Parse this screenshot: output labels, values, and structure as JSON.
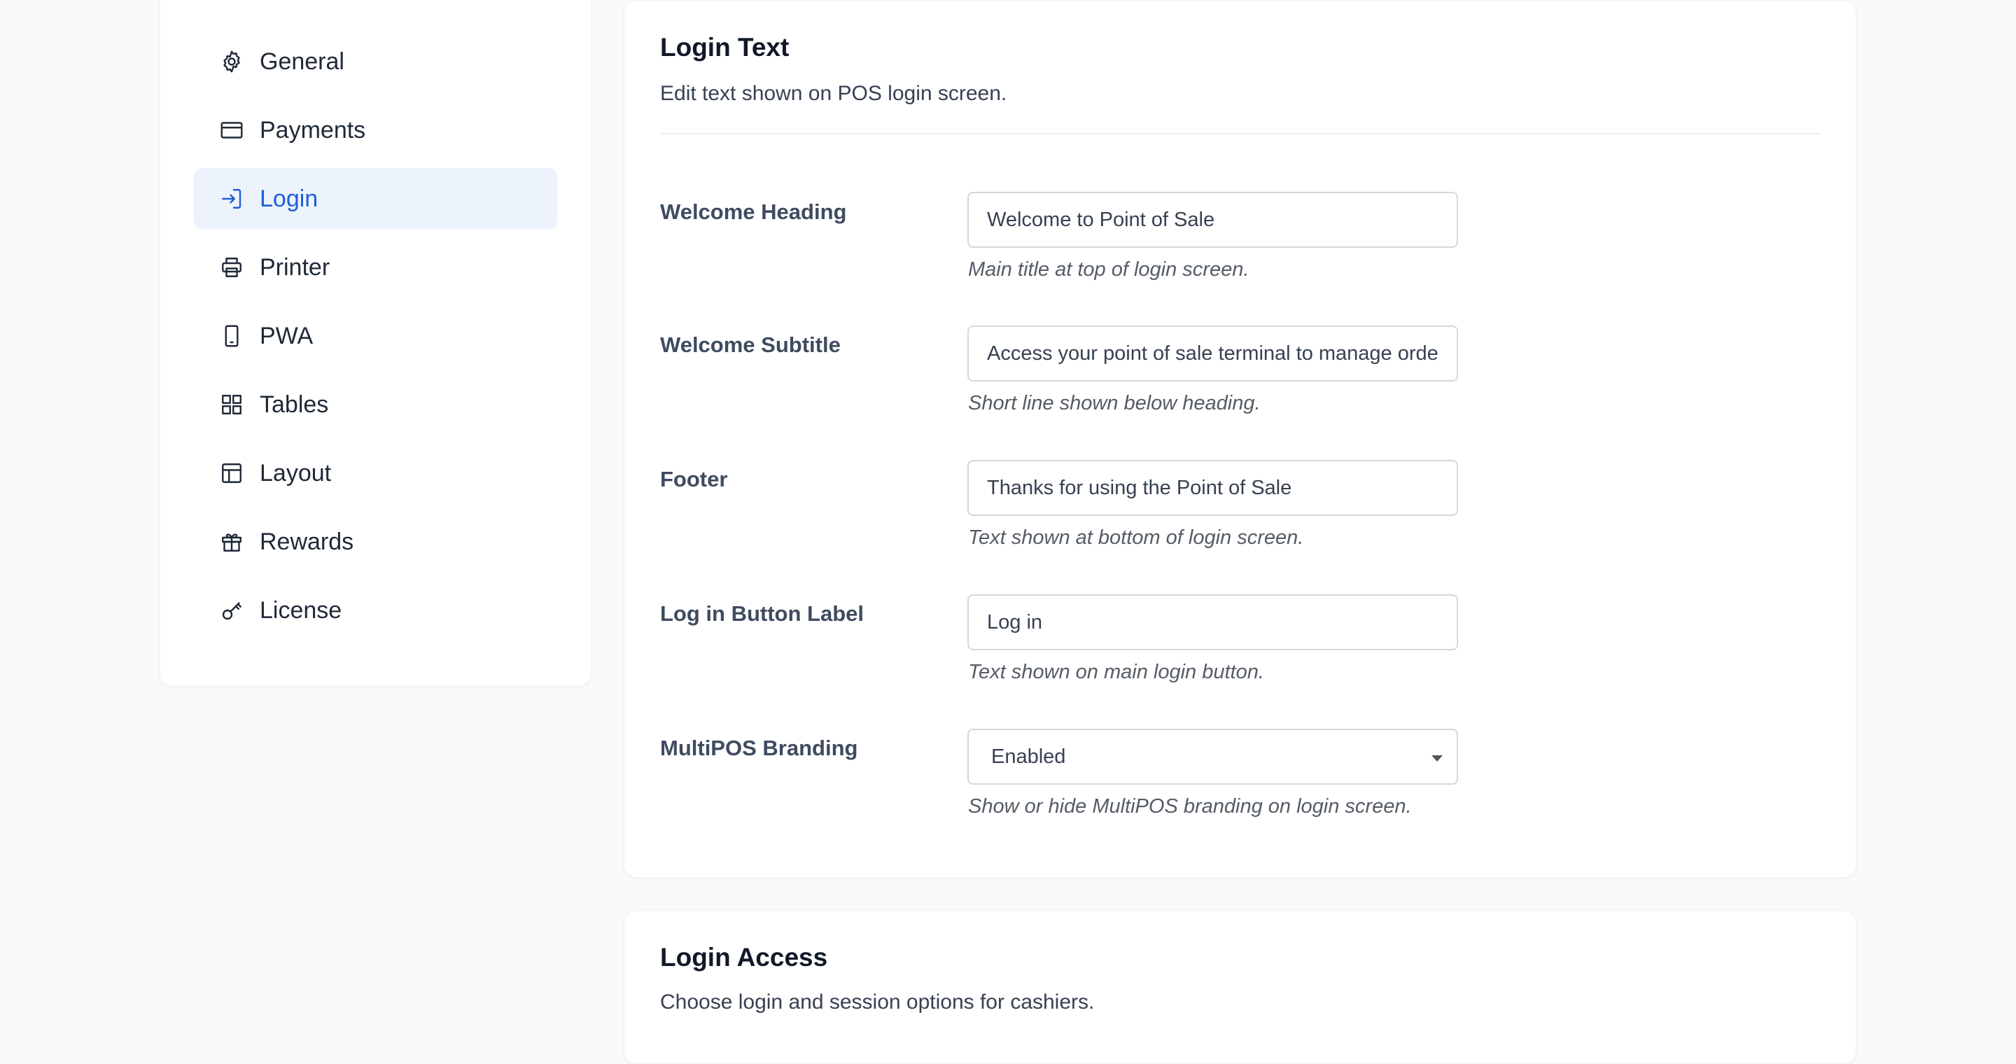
{
  "sidebar": {
    "items": [
      {
        "label": "General",
        "icon": "gear-icon"
      },
      {
        "label": "Payments",
        "icon": "credit-card-icon"
      },
      {
        "label": "Login",
        "icon": "login-icon",
        "active": true
      },
      {
        "label": "Printer",
        "icon": "printer-icon"
      },
      {
        "label": "PWA",
        "icon": "mobile-icon"
      },
      {
        "label": "Tables",
        "icon": "grid-icon"
      },
      {
        "label": "Layout",
        "icon": "layout-icon"
      },
      {
        "label": "Rewards",
        "icon": "gift-icon"
      },
      {
        "label": "License",
        "icon": "key-icon"
      }
    ]
  },
  "login_text": {
    "title": "Login Text",
    "description": "Edit text shown on POS login screen.",
    "fields": [
      {
        "label": "Welcome Heading",
        "value": "Welcome to Point of Sale",
        "hint": "Main title at top of login screen."
      },
      {
        "label": "Welcome Subtitle",
        "value": "Access your point of sale terminal to manage orde",
        "hint": "Short line shown below heading."
      },
      {
        "label": "Footer",
        "value": "Thanks for using the Point of Sale",
        "hint": "Text shown at bottom of login screen."
      },
      {
        "label": "Log in Button Label",
        "value": "Log in",
        "hint": "Text shown on main login button."
      },
      {
        "label": "MultiPOS Branding",
        "value": "Enabled",
        "hint": "Show or hide MultiPOS branding on login screen."
      }
    ]
  },
  "login_access": {
    "title": "Login Access",
    "description": "Choose login and session options for cashiers."
  },
  "colors": {
    "accent": "#1d5fd6",
    "active_bg": "#edf3fd",
    "page_bg": "#f8fafc"
  }
}
